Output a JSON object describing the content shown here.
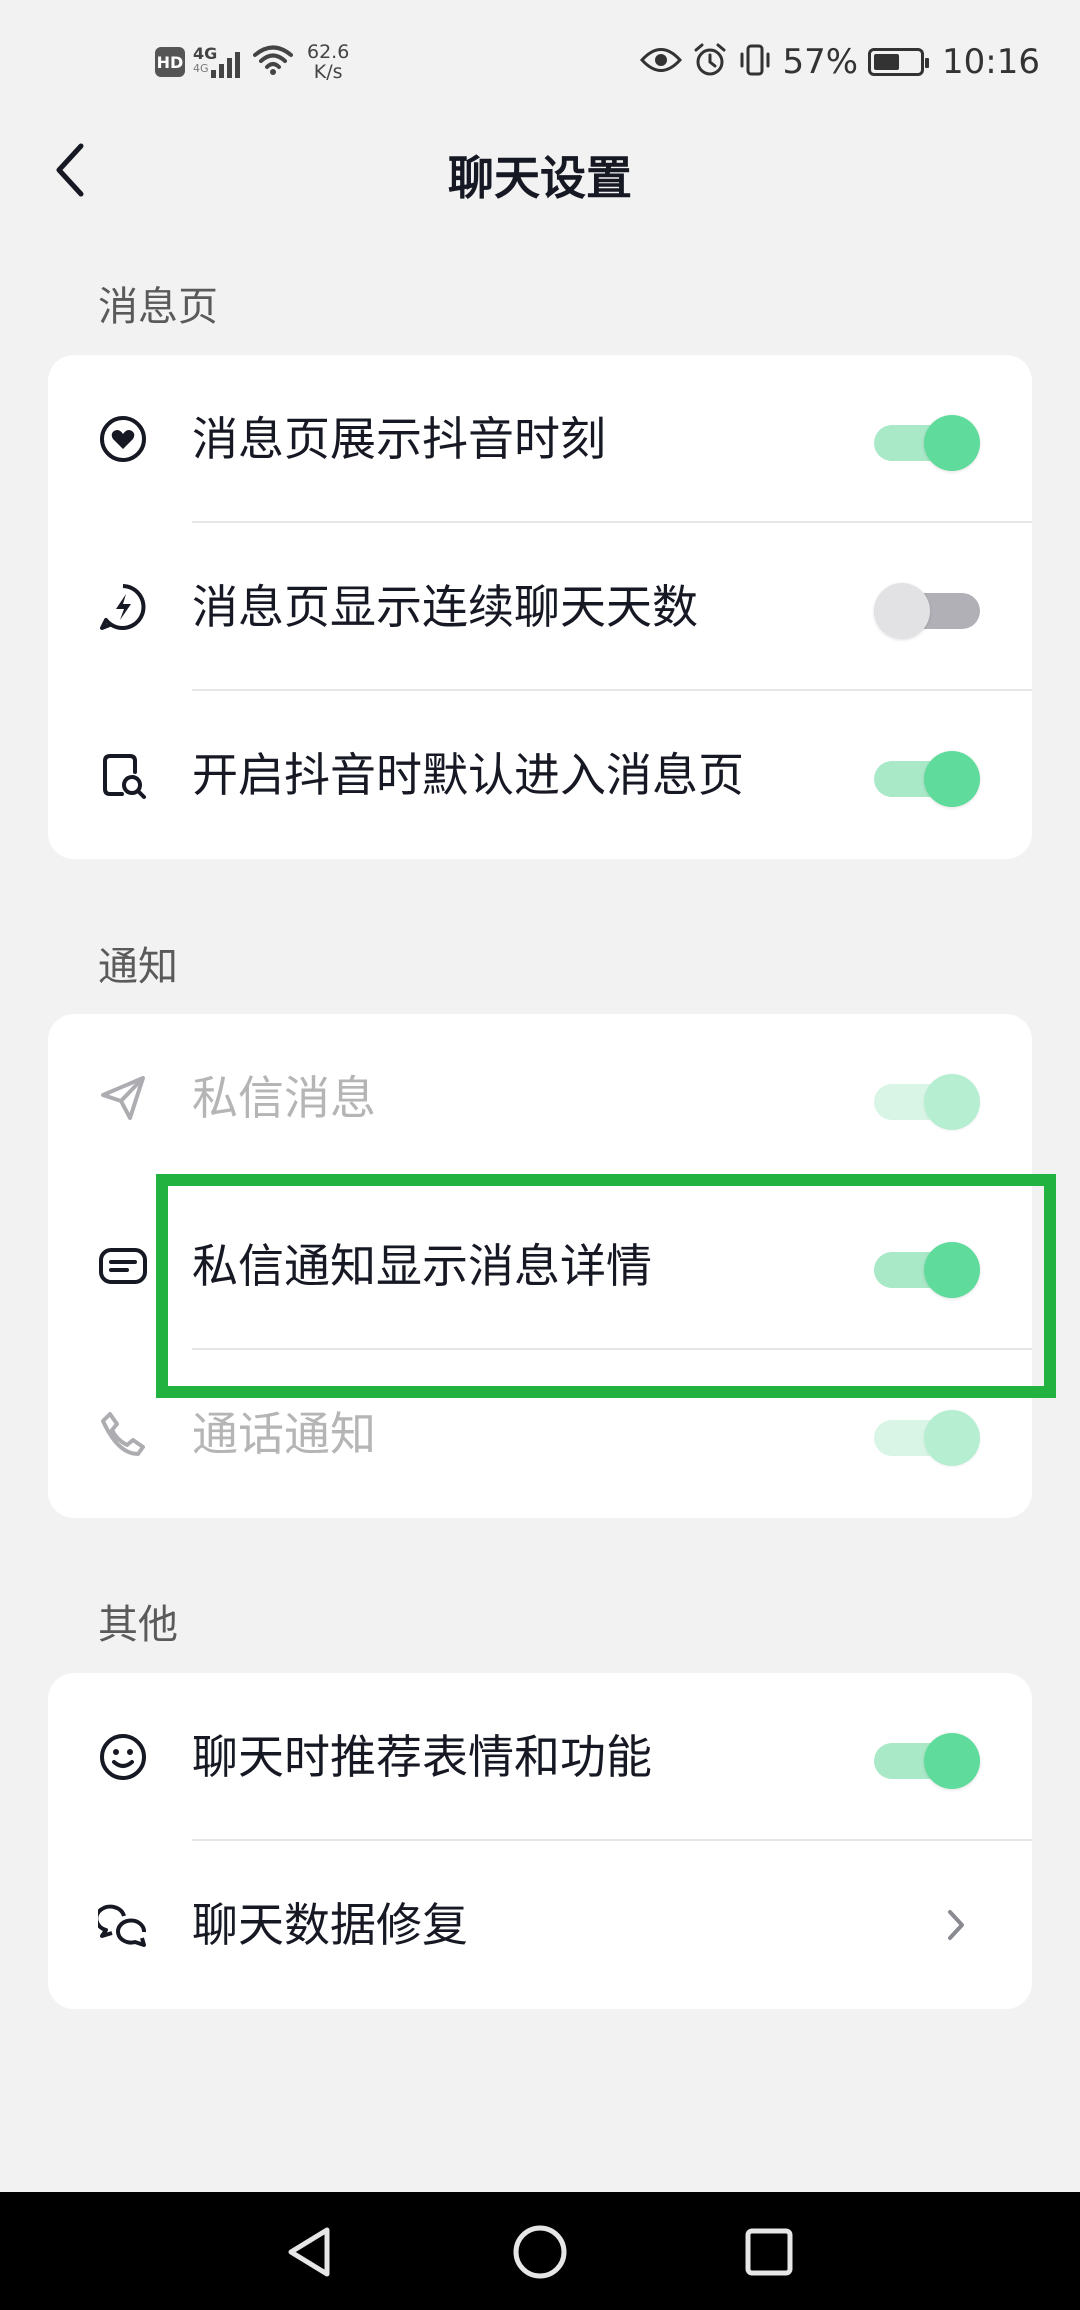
{
  "status_bar": {
    "hd": "HD",
    "network": "4G",
    "network_sub": "4G",
    "speed_value": "62.6",
    "speed_unit": "K/s",
    "battery_percent": "57%",
    "battery_level": 0.57,
    "time": "10:16"
  },
  "header": {
    "title": "聊天设置"
  },
  "sections": {
    "messages": {
      "label": "消息页",
      "items": [
        {
          "label": "消息页展示抖音时刻",
          "icon": "heart-circle-icon",
          "toggle": true
        },
        {
          "label": "消息页显示连续聊天天数",
          "icon": "lightning-bubble-icon",
          "toggle": false
        },
        {
          "label": "开启抖音时默认进入消息页",
          "icon": "document-search-icon",
          "toggle": true
        }
      ]
    },
    "notifications": {
      "label": "通知",
      "items": [
        {
          "label": "私信消息",
          "icon": "paper-plane-icon",
          "toggle": true,
          "disabled": true
        },
        {
          "label": "私信通知显示消息详情",
          "icon": "message-card-icon",
          "toggle": true
        },
        {
          "label": "通话通知",
          "icon": "phone-icon",
          "toggle": true,
          "disabled": true
        }
      ]
    },
    "other": {
      "label": "其他",
      "items": [
        {
          "label": "聊天时推荐表情和功能",
          "icon": "smiley-icon",
          "toggle": true
        },
        {
          "label": "聊天数据修复",
          "icon": "chat-bubbles-icon",
          "chevron": true
        }
      ]
    }
  },
  "colors": {
    "toggle_on_knob": "#5fdb9c",
    "toggle_on_track": "#a9e9c8",
    "toggle_off_knob": "#e2e2e5",
    "toggle_off_track": "#b1b0b6",
    "highlight_box": "#21b23f",
    "background": "#f2f2f2"
  }
}
